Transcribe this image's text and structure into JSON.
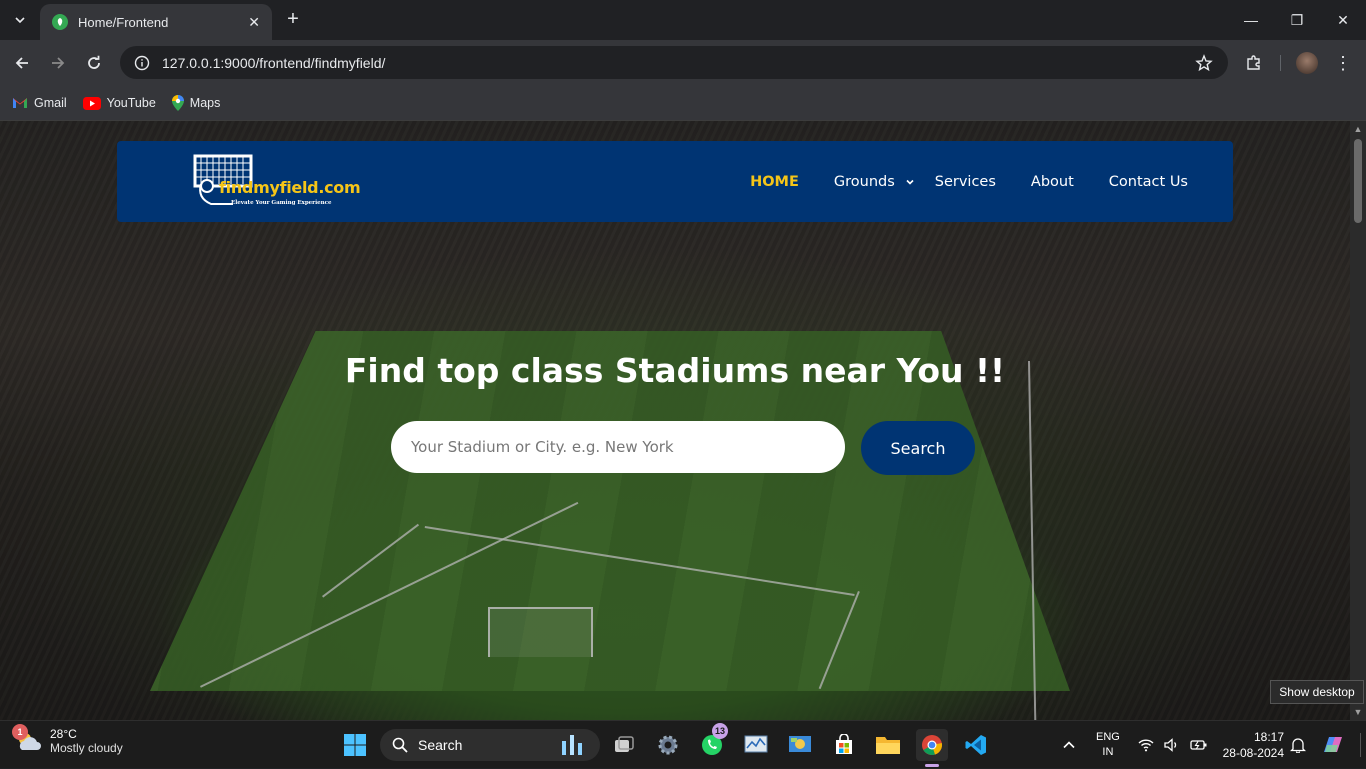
{
  "browser": {
    "tab_title": "Home/Frontend",
    "url": "127.0.0.1:9000/frontend/findmyfield/",
    "bookmarks": [
      {
        "label": "Gmail",
        "icon": "gmail-icon"
      },
      {
        "label": "YouTube",
        "icon": "youtube-icon"
      },
      {
        "label": "Maps",
        "icon": "maps-icon"
      }
    ]
  },
  "site": {
    "logo_text": "findmyfield.com",
    "logo_tagline": "Elevate Your Gaming Experience",
    "nav": {
      "home": "HOME",
      "grounds": "Grounds",
      "services": "Services",
      "about": "About",
      "contact": "Contact Us"
    },
    "hero_title": "Find top class Stadiums near You !!",
    "search_placeholder": "Your Stadium or City. e.g. New York",
    "search_button": "Search",
    "colors": {
      "navy": "#003473",
      "active_nav": "#f5c518"
    }
  },
  "tooltip": "Show desktop",
  "taskbar": {
    "weather_badge": "1",
    "temperature": "28°C",
    "condition": "Mostly cloudy",
    "search_label": "Search",
    "whatsapp_badge": "13",
    "lang": "ENG",
    "region": "IN",
    "time": "18:17",
    "date": "28-08-2024"
  }
}
